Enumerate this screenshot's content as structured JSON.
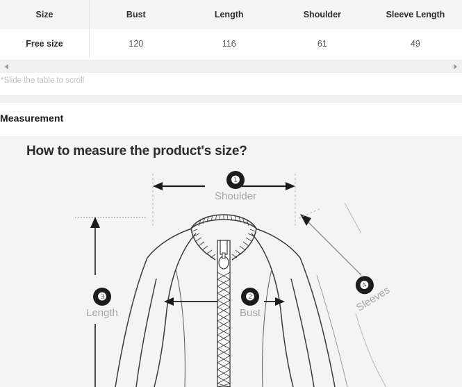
{
  "size_table": {
    "headers": [
      "Size",
      "Bust",
      "Length",
      "Shoulder",
      "Sleeve Length"
    ],
    "rows": [
      {
        "size": "Free size",
        "bust": "120",
        "length": "116",
        "shoulder": "61",
        "sleeve_length": "49"
      }
    ],
    "scroll_hint": "*Slide the table to scroll",
    "scrollbar": {
      "left_arrow_icon": "triangle-left-icon",
      "right_arrow_icon": "triangle-right-icon"
    }
  },
  "section": {
    "measurement_heading": "Measurement"
  },
  "diagram": {
    "title": "How to measure the product's size?",
    "markers": [
      {
        "number": "❶",
        "label": "Shoulder"
      },
      {
        "number": "❷",
        "label": "Bust"
      },
      {
        "number": "❸",
        "label": "Length"
      },
      {
        "number": "❹",
        "label": "Sleeves"
      }
    ],
    "illustration_name": "zip-up-jacket-line-drawing"
  },
  "colors": {
    "header_bg": "#f5f5f5",
    "panel_bg": "#f4f4f4",
    "marker_bg": "#1c1c1c",
    "label_gray": "#a6a6a6",
    "hint_gray": "#bdbdbd",
    "line_dark": "#2b2b2b"
  }
}
